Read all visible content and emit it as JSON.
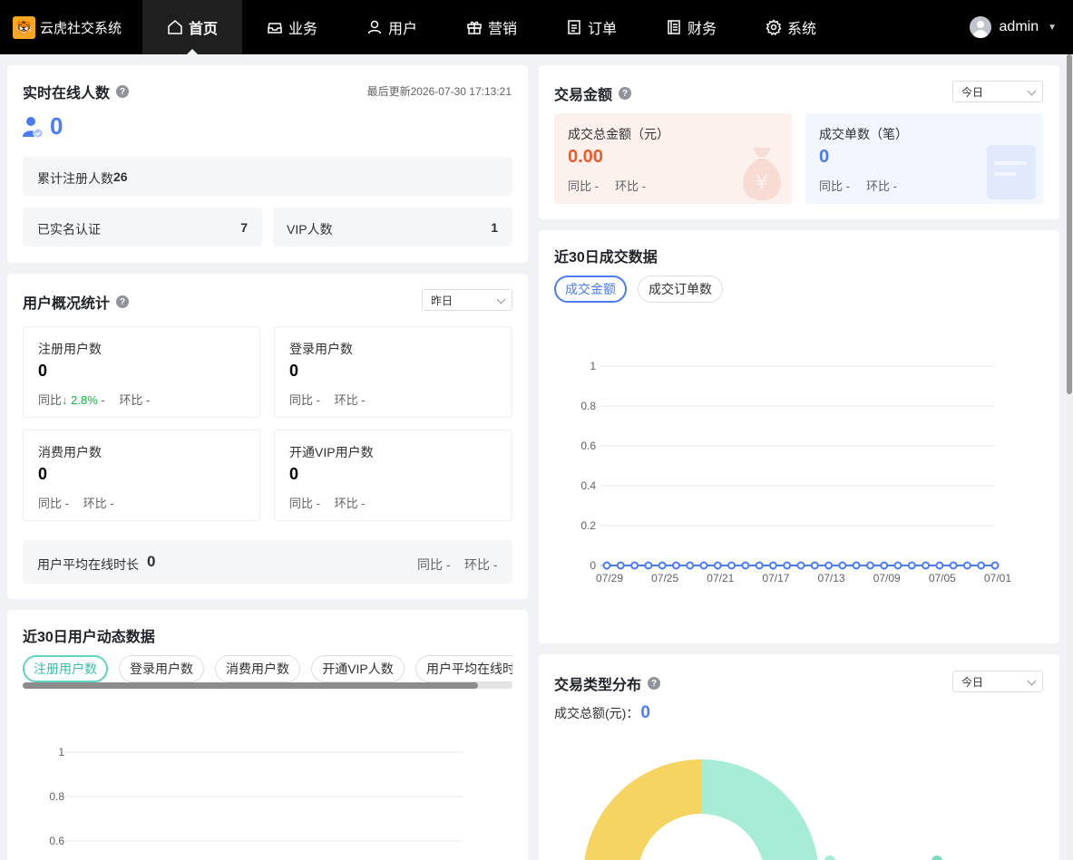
{
  "app": {
    "title": "云虎社交系统",
    "logo_icon": "tiger-logo"
  },
  "nav": {
    "items": [
      {
        "label": "首页",
        "icon": "home-icon",
        "active": true
      },
      {
        "label": "业务",
        "icon": "inbox-icon"
      },
      {
        "label": "用户",
        "icon": "user-icon"
      },
      {
        "label": "营销",
        "icon": "gift-icon"
      },
      {
        "label": "订单",
        "icon": "document-icon"
      },
      {
        "label": "财务",
        "icon": "ledger-icon"
      },
      {
        "label": "系统",
        "icon": "gear-icon"
      }
    ],
    "user": "admin"
  },
  "online": {
    "title": "实时在线人数",
    "last_update": "最后更新2026-07-30 17:13:21",
    "count": "0",
    "registered_label": "累计注册人数",
    "registered_value": "26",
    "verified_label": "已实名认证",
    "verified_value": "7",
    "vip_label": "VIP人数",
    "vip_value": "1"
  },
  "overview": {
    "title": "用户概况统计",
    "period": "昨日",
    "cards": [
      {
        "label": "注册用户数",
        "value": "0",
        "yoy_label": "同比",
        "yoy_value": "↓ 2.8%",
        "yoy_suffix": " -",
        "mom": "环比 -"
      },
      {
        "label": "登录用户数",
        "value": "0",
        "yoy": "同比 -",
        "mom": "环比 -"
      },
      {
        "label": "消费用户数",
        "value": "0",
        "yoy": "同比 -",
        "mom": "环比 -"
      },
      {
        "label": "开通VIP用户数",
        "value": "0",
        "yoy": "同比 -",
        "mom": "环比 -"
      }
    ],
    "avg_label": "用户平均在线时长",
    "avg_value": "0",
    "avg_yoy": "同比 -",
    "avg_mom": "环比 -"
  },
  "user_dynamics": {
    "title": "近30日用户动态数据",
    "tabs": [
      "注册用户数",
      "登录用户数",
      "消费用户数",
      "开通VIP人数",
      "用户平均在线时"
    ],
    "y_ticks": [
      "1",
      "0.8",
      "0.6"
    ]
  },
  "amount": {
    "title": "交易金额",
    "period": "今日",
    "total_label": "成交总金额（元）",
    "total_value": "0.00",
    "total_yoy": "同比 -",
    "total_mom": "环比 -",
    "count_label": "成交单数（笔）",
    "count_value": "0",
    "count_yoy": "同比 -",
    "count_mom": "环比 -",
    "colors": {
      "amount": "#f05a28",
      "count": "#4a7cf6"
    }
  },
  "trade30": {
    "title": "近30日成交数据",
    "tabs": [
      "成交金额",
      "成交订单数"
    ]
  },
  "type_dist": {
    "title": "交易类型分布",
    "period": "今日",
    "total_label": "成交总额(元)：",
    "total_value": "0"
  },
  "chart_data": [
    {
      "type": "line",
      "title": "近30日成交数据",
      "x": [
        "07/29",
        "07/28",
        "07/27",
        "07/26",
        "07/25",
        "07/24",
        "07/23",
        "07/22",
        "07/21",
        "07/20",
        "07/19",
        "07/18",
        "07/17",
        "07/16",
        "07/15",
        "07/14",
        "07/13",
        "07/12",
        "07/11",
        "07/10",
        "07/09",
        "07/08",
        "07/07",
        "07/06",
        "07/05",
        "07/04",
        "07/03",
        "07/02",
        "07/01"
      ],
      "x_tick_labels": [
        "07/29",
        "07/25",
        "07/21",
        "07/17",
        "07/13",
        "07/09",
        "07/05",
        "07/01"
      ],
      "series": [
        {
          "name": "成交金额",
          "values": [
            0,
            0,
            0,
            0,
            0,
            0,
            0,
            0,
            0,
            0,
            0,
            0,
            0,
            0,
            0,
            0,
            0,
            0,
            0,
            0,
            0,
            0,
            0,
            0,
            0,
            0,
            0,
            0,
            0
          ],
          "color": "#4a7cf6"
        }
      ],
      "y_ticks": [
        "1",
        "0.8",
        "0.6",
        "0.4",
        "0.2",
        "0"
      ],
      "ylim": [
        0,
        1
      ],
      "grid": true
    },
    {
      "type": "pie",
      "title": "交易类型分布",
      "slices_colors": [
        "#a6ecd6",
        "#f5d462"
      ]
    }
  ]
}
